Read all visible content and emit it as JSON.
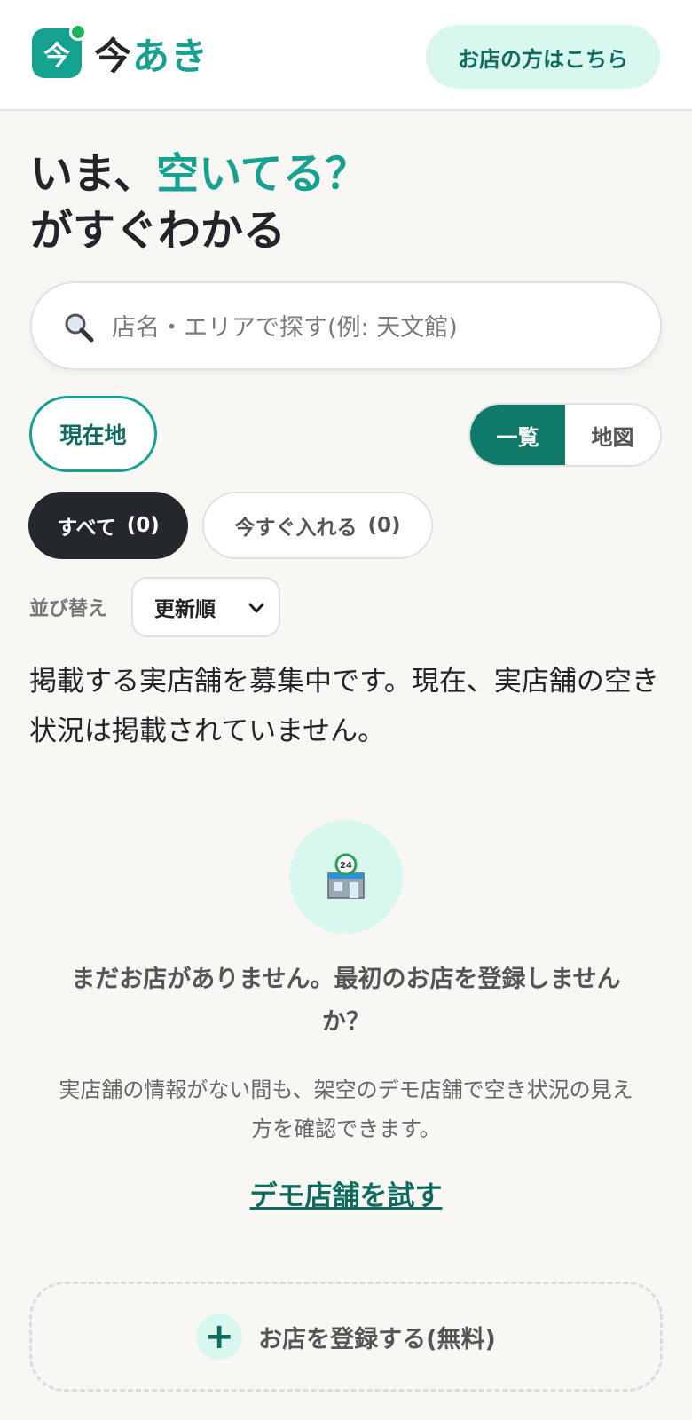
{
  "header": {
    "logo_mark": "今",
    "logo_text_1": "今",
    "logo_text_2": "あき",
    "owner_button": "お店の方はこちら"
  },
  "hero": {
    "line1_prefix": "いま、",
    "line1_accent": "空いてる？",
    "line2": "がすぐわかる"
  },
  "search": {
    "placeholder": "店名・エリアで探す(例: 天文館)",
    "value": ""
  },
  "controls": {
    "location_button": "現在地",
    "view_list": "一覧",
    "view_map": "地図",
    "active_view": "一覧"
  },
  "filters": {
    "all_label": "すべて",
    "all_count": "(0)",
    "now_label": "今すぐ入れる",
    "now_count": "(0)"
  },
  "sort": {
    "label": "並び替え",
    "selected": "更新順"
  },
  "notice": "掲載する実店舗を募集中です。現在、実店舗の空き状況は掲載されていません。",
  "empty": {
    "icon": "convenience-store-24h-icon",
    "title": "まだお店がありません。最初のお店を登録しませんか？",
    "description": "実店舗の情報がない間も、架空のデモ店舗で空き状況の見え方を確認できます。",
    "demo_link": "デモ店舗を試す"
  },
  "register": {
    "label": "お店を登録する(無料)"
  },
  "colors": {
    "accent": "#15a290",
    "accent_dark": "#0f6b5e",
    "accent_light": "#d8f7ef",
    "background": "#f8f7f4",
    "dark": "#24272b"
  }
}
